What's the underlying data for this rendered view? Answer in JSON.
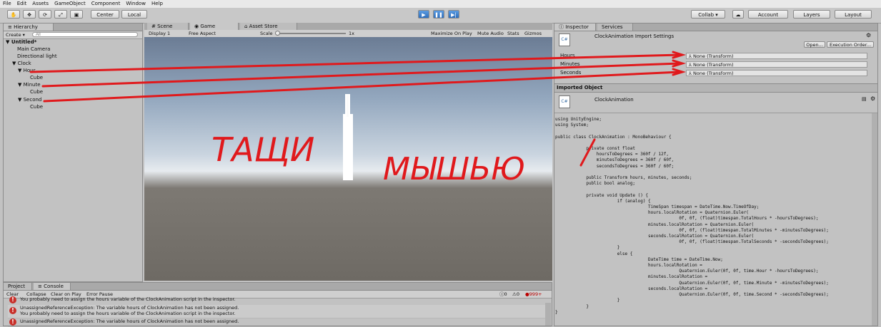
{
  "menu": [
    "File",
    "Edit",
    "Assets",
    "GameObject",
    "Component",
    "Window",
    "Help"
  ],
  "toolbar": {
    "pivot_center": "Center",
    "pivot_local": "Local",
    "collab": "Collab ▾",
    "account": "Account",
    "layers": "Layers",
    "layout": "Layout"
  },
  "hierarchy": {
    "tab": "Hierarchy",
    "create": "Create ▾",
    "search_placeholder": "All",
    "scene": "Untitled*",
    "items": [
      "Main Camera",
      "Directional light",
      "Clock",
      "Hour",
      "Cube",
      "Minute",
      "Cube",
      "Second",
      "Cube"
    ]
  },
  "center_tabs": {
    "scene": "Scene",
    "game": "Game",
    "asset_store": "Asset Store"
  },
  "game_bar": {
    "display": "Display 1",
    "aspect": "Free Aspect",
    "scale_label": "Scale",
    "scale_value": "1x",
    "maximize": "Maximize On Play",
    "mute": "Mute Audio",
    "stats": "Stats",
    "gizmos": "Gizmos"
  },
  "annotation": {
    "left": "ТАЩИ",
    "right": "МЫШЬЮ"
  },
  "inspector": {
    "tab": "Inspector",
    "services_tab": "Services",
    "title": "ClockAnimation Import Settings",
    "open_btn": "Open...",
    "exec_btn": "Execution Order...",
    "fields": [
      {
        "label": "Hours",
        "value": "None (Transform)"
      },
      {
        "label": "Minutes",
        "value": "None (Transform)"
      },
      {
        "label": "Seconds",
        "value": "None (Transform)"
      }
    ],
    "imported_header": "Imported Object",
    "imported_name": "ClockAnimation",
    "code": "using UnityEngine;\nusing System;\n\npublic class ClockAnimation : MonoBehaviour {\n\n            private const float\n                hoursToDegrees = 360f / 12f,\n                minutesToDegrees = 360f / 60f,\n                secondsToDegrees = 360f / 60f;\n\n            public Transform hours, minutes, seconds;\n            public bool analog;\n\n            private void Update () {\n                        if (analog) {\n                                    TimeSpan timespan = DateTime.Now.TimeOfDay;\n                                    hours.localRotation = Quaternion.Euler(\n                                                0f, 0f, (float)timespan.TotalHours * -hoursToDegrees);\n                                    minutes.localRotation = Quaternion.Euler(\n                                                0f, 0f, (float)timespan.TotalMinutes * -minutesToDegrees);\n                                    seconds.localRotation = Quaternion.Euler(\n                                                0f, 0f, (float)timespan.TotalSeconds * -secondsToDegrees);\n                        }\n                        else {\n                                    DateTime time = DateTime.Now;\n                                    hours.localRotation =\n                                                Quaternion.Euler(0f, 0f, time.Hour * -hoursToDegrees);\n                                    minutes.localRotation =\n                                                Quaternion.Euler(0f, 0f, time.Minute * -minutesToDegrees);\n                                    seconds.localRotation =\n                                                Quaternion.Euler(0f, 0f, time.Second * -secondsToDegrees);\n                        }\n            }\n}"
  },
  "console": {
    "project_tab": "Project",
    "console_tab": "Console",
    "buttons": [
      "Clear",
      "Collapse",
      "Clear on Play",
      "Error Pause"
    ],
    "count_info": "0",
    "count_warn": "0",
    "count_error": "999+",
    "messages": [
      {
        "line1": "",
        "line2": "You probably need to assign the hours variable of the ClockAnimation script in the inspector."
      },
      {
        "line1": "UnassignedReferenceException: The variable hours of ClockAnimation has not been assigned.",
        "line2": "You probably need to assign the hours variable of the ClockAnimation script in the inspector."
      },
      {
        "line1": "UnassignedReferenceException: The variable hours of ClockAnimation has not been assigned.",
        "line2": ""
      }
    ]
  },
  "colors": {
    "annotation_red": "#e0191c",
    "play_blue": "#3a7dcc"
  }
}
